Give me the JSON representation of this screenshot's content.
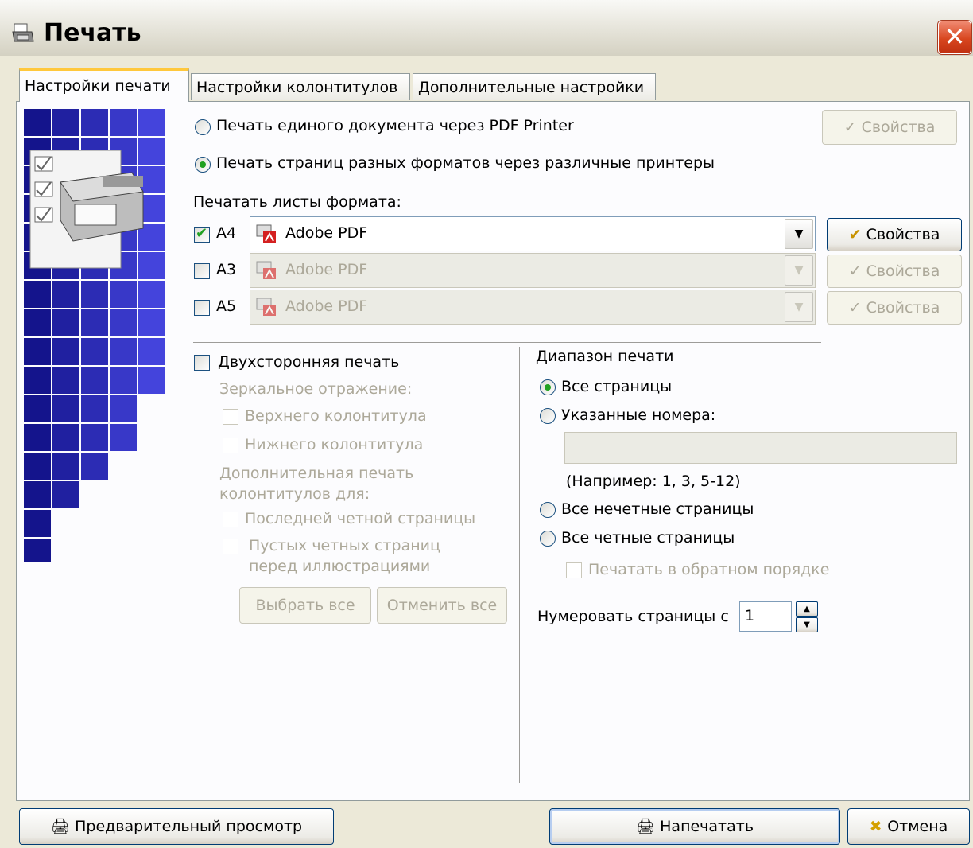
{
  "window": {
    "title": "Печать",
    "close_icon": "close-icon"
  },
  "tabs": [
    {
      "label": "Настройки печати",
      "active": true
    },
    {
      "label": "Настройки колонтитулов",
      "active": false
    },
    {
      "label": "Дополнительные настройки",
      "active": false
    }
  ],
  "print_mode": {
    "single_pdf": {
      "label": "Печать единого документа через PDF Printer",
      "selected": false,
      "properties_label": "Свойства"
    },
    "multi_printers": {
      "label": "Печать страниц разных форматов через различные принтеры",
      "selected": true
    }
  },
  "sheet_formats": {
    "heading": "Печатать листы формата:",
    "rows": [
      {
        "format": "A4",
        "checked": true,
        "printer": "Adobe PDF",
        "enabled": true,
        "properties_label": "Свойства"
      },
      {
        "format": "A3",
        "checked": false,
        "printer": "Adobe PDF",
        "enabled": false,
        "properties_label": "Свойства"
      },
      {
        "format": "A5",
        "checked": false,
        "printer": "Adobe PDF",
        "enabled": false,
        "properties_label": "Свойства"
      }
    ]
  },
  "duplex": {
    "label": "Двухсторонняя печать",
    "checked": false,
    "mirror_heading": "Зеркальное отражение:",
    "mirror_header": "Верхнего колонтитула",
    "mirror_footer": "Нижнего колонтитула",
    "extra_heading_line1": "Дополнительная печать",
    "extra_heading_line2": "колонтитулов для:",
    "last_even_page": "Последней четной страницы",
    "empty_even_line1": "Пустых четных страниц",
    "empty_even_line2": "перед иллюстрациями",
    "select_all": "Выбрать все",
    "deselect_all": "Отменить все"
  },
  "range": {
    "heading": "Диапазон печати",
    "all_pages": {
      "label": "Все страницы",
      "selected": true
    },
    "specified": {
      "label": "Указанные номера:",
      "selected": false,
      "value": ""
    },
    "example": "(Например: 1, 3, 5-12)",
    "odd": {
      "label": "Все нечетные страницы",
      "selected": false
    },
    "even": {
      "label": "Все четные страницы",
      "selected": false
    },
    "reverse": {
      "label": "Печатать в обратном порядке",
      "checked": false
    },
    "numbering_label": "Нумеровать страницы с",
    "numbering_value": "1"
  },
  "footer": {
    "preview": "Предварительный просмотр",
    "print": "Напечатать",
    "cancel": "Отмена"
  },
  "colors": {
    "accent_tab": "#ffc83c",
    "side_art": "#1a1a9a",
    "check_green": "#21a121"
  }
}
